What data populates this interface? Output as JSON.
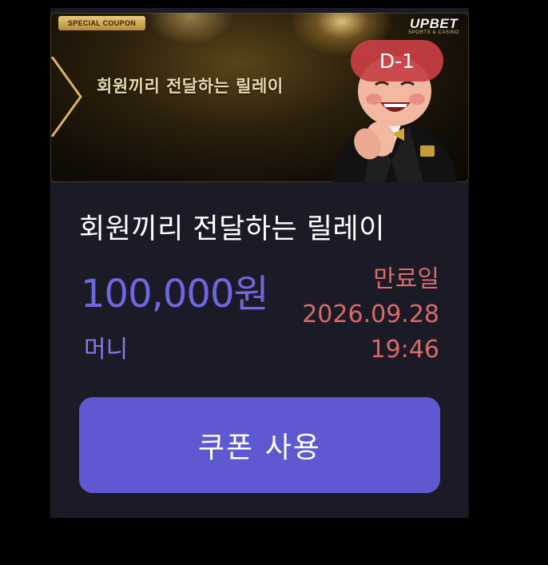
{
  "banner": {
    "tag": "SPECIAL COUPON",
    "brand_name": "UPBET",
    "brand_sub": "SPORTS & CASINO",
    "title": "회원끼리 전달하는 릴레이",
    "d_day": "D-1"
  },
  "coupon": {
    "title": "회원끼리 전달하는 릴레이",
    "amount": "100,000원",
    "currency_type": "머니",
    "expiry_label": "만료일",
    "expiry_date": "2026.09.28",
    "expiry_time": "19:46",
    "use_button_label": "쿠폰 사용"
  },
  "colors": {
    "card_bg": "#1b1b27",
    "accent_purple": "#5e58d1",
    "amount_purple": "#6d68e0",
    "expiry_red": "#d86a68",
    "badge_red": "#c93f44"
  }
}
